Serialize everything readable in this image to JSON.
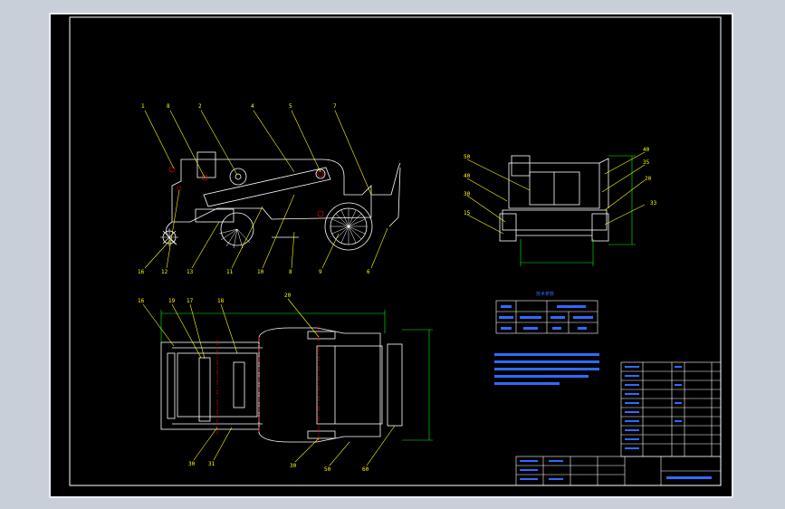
{
  "drawing": {
    "colors": {
      "background": "#000000",
      "frame": "#ffffff",
      "leader": "#ffff00",
      "dimension": "#00ff00",
      "centerline": "#ff0000",
      "parts": "#ffffff",
      "notes": "#2f6bff"
    },
    "side_view": {
      "top_balloons": [
        "1",
        "8",
        "2",
        "4",
        "5",
        "7"
      ],
      "bottom_balloons": [
        "16",
        "12",
        "13",
        "11",
        "10",
        "8",
        "9",
        "6"
      ]
    },
    "rear_view": {
      "left_balloons": [
        "50",
        "40",
        "30",
        "15"
      ],
      "right_balloons": [
        "40",
        "35",
        "20",
        "33"
      ]
    },
    "top_view": {
      "top_balloons": [
        "16",
        "19",
        "17",
        "18",
        "20"
      ],
      "bottom_balloons": [
        "30",
        "31",
        "30",
        "50",
        "60"
      ]
    },
    "params_table": {
      "title": "技术参数"
    }
  }
}
